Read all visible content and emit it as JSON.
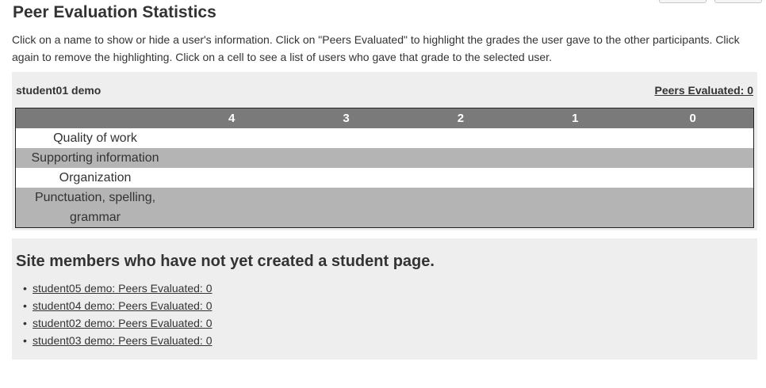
{
  "page": {
    "title": "Peer Evaluation Statistics",
    "intro": "Click on a name to show or hide a user's information. Click on \"Peers Evaluated\" to highlight the grades the user gave to the other participants. Click again to remove the highlighting. Click on a cell to see a list of users who gave that grade to the selected user."
  },
  "user_panel": {
    "name": "student01 demo",
    "peers_evaluated": "Peers Evaluated: 0",
    "grade_headers": [
      "4",
      "3",
      "2",
      "1",
      "0"
    ],
    "criteria": [
      "Quality of work",
      "Supporting information",
      "Organization",
      "Punctuation, spelling, grammar"
    ]
  },
  "members_panel": {
    "heading": "Site members who have not yet created a student page.",
    "bullet": "•",
    "items": [
      "student05 demo: Peers Evaluated: 0",
      "student04 demo: Peers Evaluated: 0",
      "student02 demo: Peers Evaluated: 0",
      "student03 demo: Peers Evaluated: 0"
    ]
  }
}
